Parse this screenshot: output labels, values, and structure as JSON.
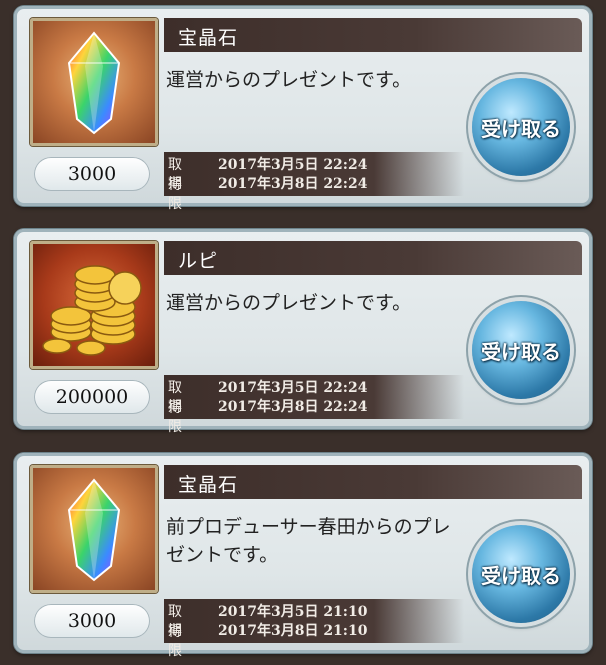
{
  "presents": [
    {
      "item_name": "宝晶石",
      "icon": "gem-icon",
      "description": "運営からのプレゼントです。",
      "quantity": "3000",
      "obtained_label": "取得",
      "obtained_value": "2017年3月5日 22:24",
      "expires_label": "期限",
      "expires_value": "2017年3月8日 22:24",
      "receive_label": "受け取る"
    },
    {
      "item_name": "ルピ",
      "icon": "coin-stack-icon",
      "description": "運営からのプレゼントです。",
      "quantity": "200000",
      "obtained_label": "取得",
      "obtained_value": "2017年3月5日 22:24",
      "expires_label": "期限",
      "expires_value": "2017年3月8日 22:24",
      "receive_label": "受け取る"
    },
    {
      "item_name": "宝晶石",
      "icon": "gem-icon",
      "description": "前プロデューサー春田からのプレゼントです。",
      "quantity": "3000",
      "obtained_label": "取得",
      "obtained_value": "2017年3月5日 21:10",
      "expires_label": "期限",
      "expires_value": "2017年3月8日 21:10",
      "receive_label": "受け取る"
    }
  ]
}
